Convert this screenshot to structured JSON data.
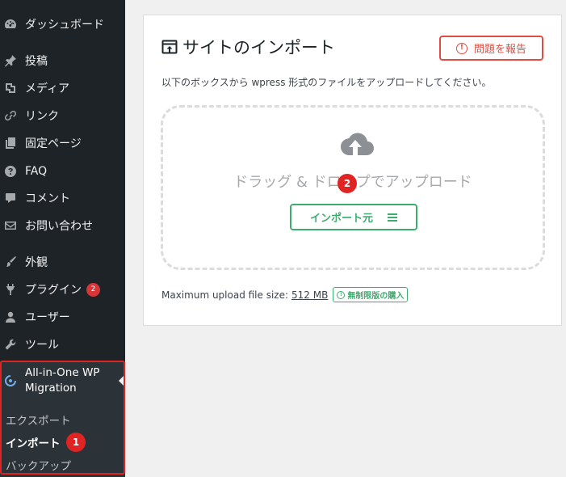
{
  "sidebar": {
    "items": [
      {
        "label": "ダッシュボード",
        "icon": "dashboard-icon"
      },
      {
        "label": "投稿",
        "icon": "pin-icon"
      },
      {
        "label": "メディア",
        "icon": "media-icon"
      },
      {
        "label": "リンク",
        "icon": "link-icon"
      },
      {
        "label": "固定ページ",
        "icon": "page-icon"
      },
      {
        "label": "FAQ",
        "icon": "question-icon"
      },
      {
        "label": "コメント",
        "icon": "comment-icon"
      },
      {
        "label": "お問い合わせ",
        "icon": "mail-icon"
      },
      {
        "label": "外観",
        "icon": "brush-icon"
      },
      {
        "label": "プラグイン",
        "icon": "plugin-icon",
        "badge": "2"
      },
      {
        "label": "ユーザー",
        "icon": "user-icon"
      },
      {
        "label": "ツール",
        "icon": "wrench-icon"
      }
    ],
    "active": {
      "label": "All-in-One WP Migration",
      "icon": "migration-icon"
    },
    "submenu": [
      {
        "label": "エクスポート"
      },
      {
        "label": "インポート"
      },
      {
        "label": "バックアップ"
      }
    ],
    "highlight_color": "#e02424"
  },
  "annotations": {
    "one": "1",
    "two": "2"
  },
  "panel": {
    "title": "サイトのインポート",
    "report_label": "問題を報告",
    "description": "以下のボックスから wpress 形式のファイルをアップロードしてください。",
    "drop_text": "ドラッグ & ドロップでアップロード",
    "import_label": "インポート元",
    "max_upload_label": "Maximum upload file size:",
    "max_upload_size": "512 MB",
    "unlimited_label": "無制限版の購入",
    "accent_green": "#3dad6f",
    "accent_red": "#e14d43"
  }
}
